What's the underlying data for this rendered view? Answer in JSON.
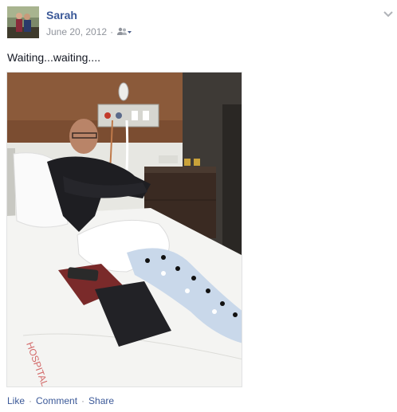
{
  "post": {
    "author": "Sarah",
    "date": "June 20, 2012",
    "separator": "·",
    "audience_icon": "friends-icon",
    "status_text": "Waiting...waiting....",
    "photo_subject": "hospital-bed-photo"
  },
  "actions": {
    "like": "Like",
    "comment": "Comment",
    "share": "Share",
    "separator": "·"
  },
  "colors": {
    "link": "#3b5998",
    "meta": "#90949c",
    "text": "#141823"
  }
}
